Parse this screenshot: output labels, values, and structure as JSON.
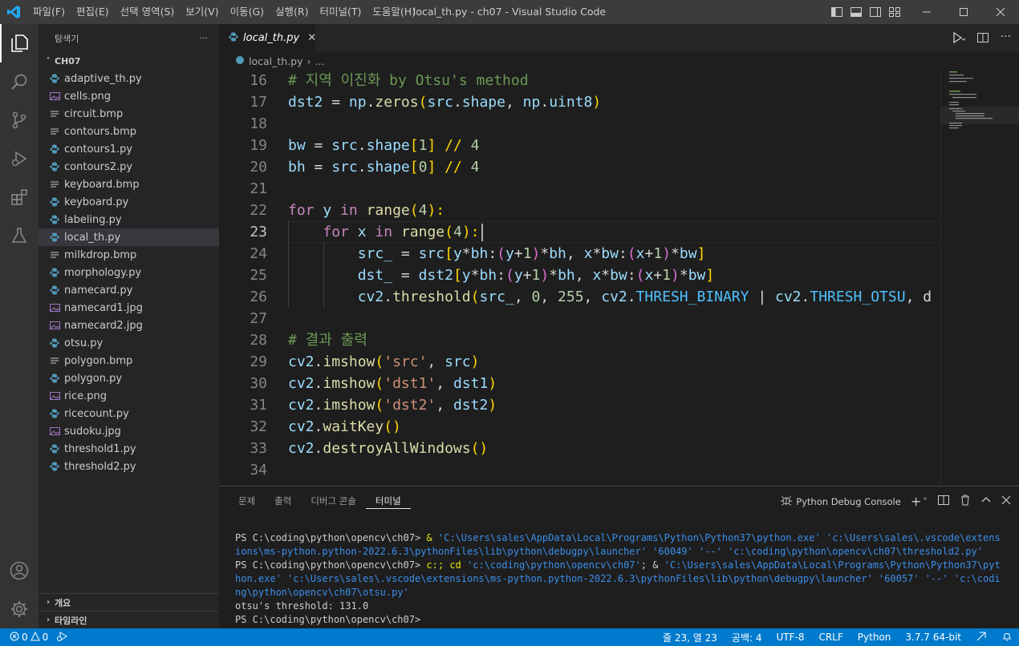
{
  "window": {
    "title": "local_th.py - ch07 - Visual Studio Code",
    "menu": [
      "파일(F)",
      "편집(E)",
      "선택 영역(S)",
      "보기(V)",
      "이동(G)",
      "실행(R)",
      "터미널(T)",
      "도움말(H)"
    ]
  },
  "sidebar": {
    "title": "탐색기",
    "more": "···",
    "folder": "CH07",
    "files": [
      {
        "name": "adaptive_th.py",
        "type": "py"
      },
      {
        "name": "cells.png",
        "type": "img"
      },
      {
        "name": "circuit.bmp",
        "type": "bmp"
      },
      {
        "name": "contours.bmp",
        "type": "bmp"
      },
      {
        "name": "contours1.py",
        "type": "py"
      },
      {
        "name": "contours2.py",
        "type": "py"
      },
      {
        "name": "keyboard.bmp",
        "type": "bmp"
      },
      {
        "name": "keyboard.py",
        "type": "py"
      },
      {
        "name": "labeling.py",
        "type": "py"
      },
      {
        "name": "local_th.py",
        "type": "py",
        "selected": true
      },
      {
        "name": "milkdrop.bmp",
        "type": "bmp"
      },
      {
        "name": "morphology.py",
        "type": "py"
      },
      {
        "name": "namecard.py",
        "type": "py"
      },
      {
        "name": "namecard1.jpg",
        "type": "img"
      },
      {
        "name": "namecard2.jpg",
        "type": "img"
      },
      {
        "name": "otsu.py",
        "type": "py"
      },
      {
        "name": "polygon.bmp",
        "type": "bmp"
      },
      {
        "name": "polygon.py",
        "type": "py"
      },
      {
        "name": "rice.png",
        "type": "img"
      },
      {
        "name": "ricecount.py",
        "type": "py"
      },
      {
        "name": "sudoku.jpg",
        "type": "img"
      },
      {
        "name": "threshold1.py",
        "type": "py"
      },
      {
        "name": "threshold2.py",
        "type": "py"
      }
    ],
    "outline": "개요",
    "timeline": "타임라인"
  },
  "editor": {
    "tab": "local_th.py",
    "breadcrumb": {
      "file": "local_th.py",
      "rest": "..."
    },
    "lines": [
      "16",
      "17",
      "18",
      "19",
      "20",
      "21",
      "22",
      "23",
      "24",
      "25",
      "26",
      "27",
      "28",
      "29",
      "30",
      "31",
      "32",
      "33",
      "34"
    ],
    "code": {
      "l16": "# 지역 이진화 by Otsu's method",
      "l17": [
        "dst2",
        " = ",
        "np",
        ".",
        "zeros",
        "(",
        "src",
        ".",
        "shape",
        ", ",
        "np",
        ".",
        "uint8",
        ")"
      ],
      "l19": [
        "bw",
        " = ",
        "src",
        ".",
        "shape",
        "[",
        "1",
        "] // ",
        "4"
      ],
      "l20": [
        "bh",
        " = ",
        "src",
        ".",
        "shape",
        "[",
        "0",
        "] // ",
        "4"
      ],
      "l22": [
        "for",
        " ",
        "y",
        " ",
        "in",
        " ",
        "range",
        "(",
        "4",
        "):"
      ],
      "l23": [
        "for",
        " ",
        "x",
        " ",
        "in",
        " ",
        "range",
        "(",
        "4",
        "):"
      ],
      "l24": [
        "src_",
        " = ",
        "src",
        "[",
        "y",
        "*",
        "bh",
        ":",
        "(",
        "y",
        "+",
        "1",
        ")",
        "*",
        "bh",
        ", ",
        "x",
        "*",
        "bw",
        ":",
        "(",
        "x",
        "+",
        "1",
        ")",
        "*",
        "bw",
        "]"
      ],
      "l25": [
        "dst_",
        " = ",
        "dst2",
        "[",
        "y",
        "*",
        "bh",
        ":",
        "(",
        "y",
        "+",
        "1",
        ")",
        "*",
        "bh",
        ", ",
        "x",
        "*",
        "bw",
        ":",
        "(",
        "x",
        "+",
        "1",
        ")",
        "*",
        "bw",
        "]"
      ],
      "l26": [
        "cv2",
        ".",
        "threshold",
        "(",
        "src_",
        ", ",
        "0",
        ", ",
        "255",
        ", ",
        "cv2",
        ".",
        "THRESH_BINARY",
        " | ",
        "cv2",
        ".",
        "THRESH_OTSU",
        ", d"
      ],
      "l28": "# 결과 출력",
      "l29": [
        "cv2",
        ".",
        "imshow",
        "(",
        "'src'",
        ", ",
        "src",
        ")"
      ],
      "l30": [
        "cv2",
        ".",
        "imshow",
        "(",
        "'dst1'",
        ", ",
        "dst1",
        ")"
      ],
      "l31": [
        "cv2",
        ".",
        "imshow",
        "(",
        "'dst2'",
        ", ",
        "dst2",
        ")"
      ],
      "l32": [
        "cv2",
        ".",
        "waitKey",
        "()"
      ],
      "l33": [
        "cv2",
        ".",
        "destroyAllWindows",
        "()"
      ]
    }
  },
  "panel": {
    "tabs": [
      "문제",
      "출력",
      "디버그 콘솔",
      "터미널"
    ],
    "active_tab": "터미널",
    "console_name": "Python Debug Console",
    "terminal": {
      "p1": "PS C:\\coding\\python\\opencv\\ch07> ",
      "c1a": " & ",
      "c1b": "'C:\\Users\\sales\\AppData\\Local\\Programs\\Python\\Python37\\python.exe' 'c:\\Users\\sales\\.vscode\\extensions\\ms-python.python-2022.6.3\\pythonFiles\\lib\\python\\debugpy\\launcher' '60049' '--' 'c:\\coding\\python\\opencv\\ch07\\threshold2.py'",
      "p2": "PS C:\\coding\\python\\opencv\\ch07> ",
      "c2a": " c:; cd ",
      "c2b": "'c:\\coding\\python\\opencv\\ch07'",
      "c2c": "; & ",
      "c2d": "'C:\\Users\\sales\\AppData\\Local\\Programs\\Python\\Python37\\python.exe' 'c:\\Users\\sales\\.vscode\\extensions\\ms-python.python-2022.6.3\\pythonFiles\\lib\\python\\debugpy\\launcher' '60057' '--' 'c:\\coding\\python\\opencv\\ch07\\otsu.py'",
      "out": "otsu's threshold: 131.0",
      "p3": "PS C:\\coding\\python\\opencv\\ch07> "
    }
  },
  "statusbar": {
    "errors": "0",
    "warnings": "0",
    "position": "줄 23, 열 23",
    "spaces": "공백: 4",
    "encoding": "UTF-8",
    "eol": "CRLF",
    "language": "Python",
    "interpreter": "3.7.7 64-bit"
  },
  "colors": {
    "accent": "#007acc",
    "editor_bg": "#1e1e1e",
    "sidebar_bg": "#252526",
    "activity_bg": "#333333"
  }
}
